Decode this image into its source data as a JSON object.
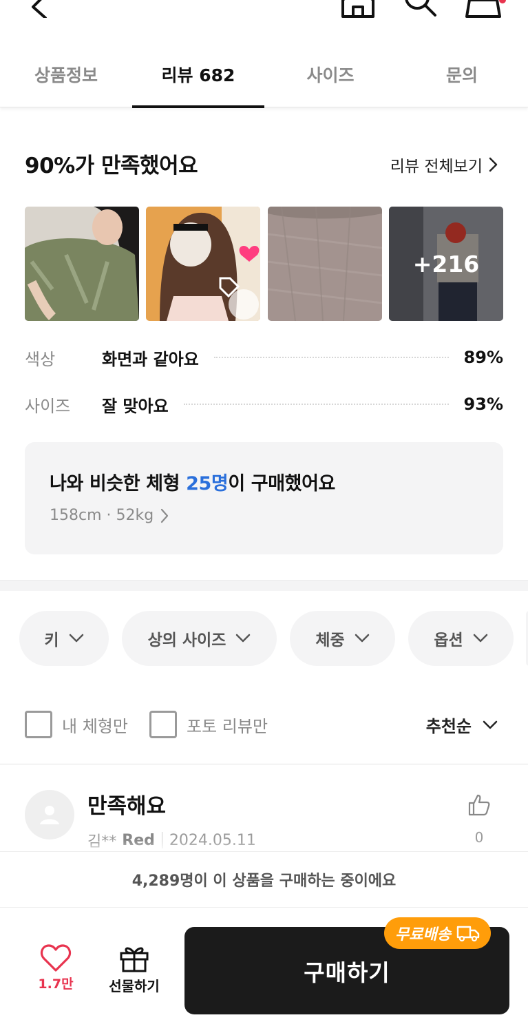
{
  "tabs": [
    {
      "label": "상품정보"
    },
    {
      "label": "리뷰 682"
    },
    {
      "label": "사이즈"
    },
    {
      "label": "문의"
    }
  ],
  "summary": {
    "title": "90%가 만족했어요",
    "view_all": "리뷰 전체보기",
    "more_photos": "+216",
    "stats": [
      {
        "key": "색상",
        "value": "화면과 같아요",
        "percent": "89%"
      },
      {
        "key": "사이즈",
        "value": "잘 맞아요",
        "percent": "93%"
      }
    ]
  },
  "similar": {
    "prefix": "나와 비슷한 체형 ",
    "highlight": "25명",
    "suffix": "이 구매했어요",
    "body": "158cm · 52kg"
  },
  "filters": [
    {
      "label": "키"
    },
    {
      "label": "상의 사이즈"
    },
    {
      "label": "체중"
    },
    {
      "label": "옵션"
    }
  ],
  "checks": {
    "my_body": "내 체형만",
    "photo_only": "포토 리뷰만"
  },
  "sort": {
    "label": "추천순"
  },
  "review": {
    "title": "만족해요",
    "author": "김**",
    "option": "Red",
    "date": "2024.05.11",
    "likes": "0"
  },
  "buying_banner": "4,289명이 이 상품을 구매하는 중이에요",
  "bottom": {
    "wish_count": "1.7만",
    "gift_label": "선물하기",
    "buy_label": "구매하기",
    "free_ship": "무료배송"
  },
  "colors": {
    "accent_blue": "#2a6fdb",
    "wish_red": "#e8344f",
    "free_ship_orange": "#ff9d0a",
    "buy_button": "#1b1b1b"
  }
}
